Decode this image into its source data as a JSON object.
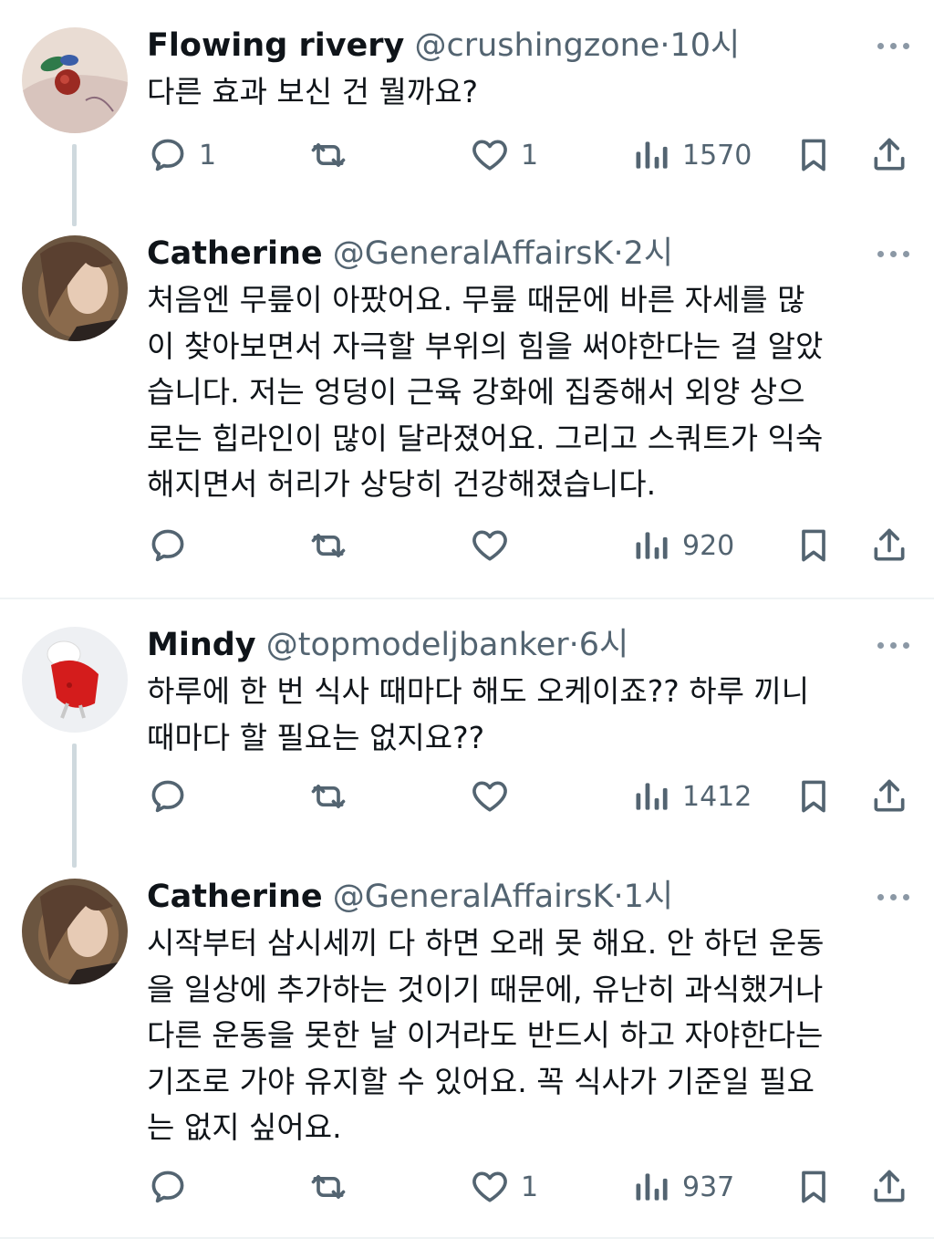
{
  "colors": {
    "text": "#0f1419",
    "secondary": "#536471",
    "thread_line": "#cfd9de",
    "icon": "#536471"
  },
  "tweets": [
    {
      "name": "Flowing rivery",
      "handle": "@crushingzone",
      "separator": "·",
      "time": "10시",
      "text": "다른 효과 보신 건 뭘까요?",
      "replies": "1",
      "retweets": "",
      "likes": "1",
      "views": "1570",
      "avatar_icon": "avatar-photo"
    },
    {
      "name": "Catherine",
      "handle": "@GeneralAffairsK",
      "separator": "·",
      "time": "2시",
      "text": "처음엔 무릎이 아팠어요. 무릎 때문에 바른 자세를 많\n이 찾아보면서 자극할 부위의 힘을 써야한다는 걸 알았\n습니다. 저는 엉덩이 근육 강화에 집중해서 외양 상으\n로는 힙라인이 많이 달라졌어요. 그리고 스쿼트가 익숙\n해지면서 허리가 상당히 건강해졌습니다.",
      "replies": "",
      "retweets": "",
      "likes": "",
      "views": "920",
      "avatar_icon": "avatar-photo"
    },
    {
      "name": "Mindy",
      "handle": "@topmodeljbanker",
      "separator": "·",
      "time": "6시",
      "text": "하루에 한 번 식사 때마다 해도 오케이죠?? 하루 끼니\n때마다 할 필요는 없지요??",
      "replies": "",
      "retweets": "",
      "likes": "",
      "views": "1412",
      "avatar_icon": "avatar-photo"
    },
    {
      "name": "Catherine",
      "handle": "@GeneralAffairsK",
      "separator": "·",
      "time": "1시",
      "text": "시작부터 삼시세끼 다 하면 오래 못 해요. 안 하던 운동\n을 일상에 추가하는 것이기 때문에, 유난히 과식했거나\n다른 운동을 못한 날 이거라도 반드시 하고 자야한다는\n기조로 가야 유지할 수 있어요. 꼭 식사가 기준일 필요\n는 없지 싶어요.",
      "replies": "",
      "retweets": "",
      "likes": "1",
      "views": "937",
      "avatar_icon": "avatar-photo"
    }
  ]
}
